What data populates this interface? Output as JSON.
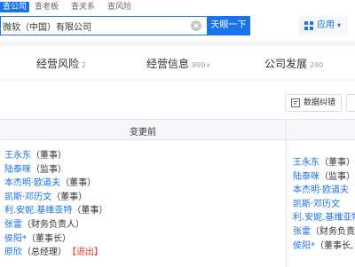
{
  "nav": {
    "tabs": [
      "查公司",
      "查老板",
      "查关系",
      "查风险"
    ]
  },
  "search": {
    "value": "微软（中国）有限公司",
    "button": "天眼一下"
  },
  "apps": {
    "label": "应用"
  },
  "section_tabs": [
    {
      "label": "经营风险",
      "count": "2"
    },
    {
      "label": "经营信息",
      "count": "999+"
    },
    {
      "label": "公司发展",
      "count": "290"
    }
  ],
  "toolbar": {
    "report_label": "数据纠错"
  },
  "table": {
    "header_before": "变更前",
    "before": [
      {
        "name": "王永东",
        "role": "（董事）"
      },
      {
        "name": "陆泰咪",
        "role": "（监事）"
      },
      {
        "name": "本杰明·欧道夫",
        "role": "（董事）"
      },
      {
        "name": "凯斯·邓历文",
        "role": "（董事）"
      },
      {
        "name": "利.安妮.基维亚特",
        "role": "（董事）"
      },
      {
        "name": "张雷",
        "role": "（财务负责人）"
      },
      {
        "name": "侯阳*",
        "role": "（董事长）"
      },
      {
        "name": "原欣",
        "role": "（总经理）",
        "exit": "【退出】"
      }
    ],
    "after": [
      {
        "name": "王永东",
        "role": "（董事）"
      },
      {
        "name": "陆泰咪",
        "role": "（监事）"
      },
      {
        "name": "本杰明·欧道夫",
        "role": ""
      },
      {
        "name": "凯斯·邓历文",
        "role": ""
      },
      {
        "name": "利.安妮.基维亚特",
        "role": ""
      },
      {
        "name": "张雷",
        "role": "（财务负责"
      },
      {
        "name": "侯阳*",
        "role": "（董事长,"
      }
    ]
  }
}
